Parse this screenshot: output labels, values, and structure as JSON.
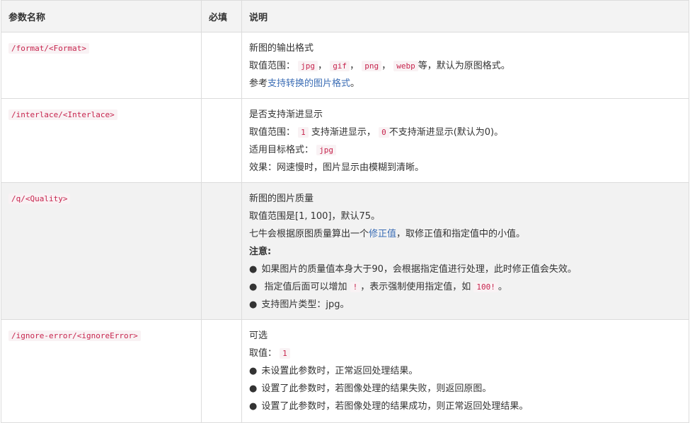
{
  "header": {
    "col_name": "参数名称",
    "col_required": "必填",
    "col_desc": "说明"
  },
  "rows": [
    {
      "name": "/format/<Format>",
      "required": "",
      "title": "新图的输出格式",
      "range_prefix": "取值范围：",
      "formats": [
        "jpg",
        "gif",
        "png",
        "webp"
      ],
      "range_sep": "，",
      "range_suffix": "等，默认为原图格式。",
      "ref_prefix": "参考",
      "ref_link": "支持转换的图片格式",
      "ref_suffix": "。"
    },
    {
      "name": "/interlace/<Interlace>",
      "required": "",
      "title": "是否支持渐进显示",
      "range_prefix": "取值范围：",
      "val1": "1",
      "val1_text": "支持渐进显示，",
      "val0": "0",
      "val0_text": "不支持渐进显示(默认为0)。",
      "target_prefix": "适用目标格式：",
      "target_code": "jpg",
      "effect": "效果：网速慢时，图片显示由模糊到清晰。"
    },
    {
      "name": "/q/<Quality>",
      "required": "",
      "title": "新图的图片质量",
      "range": "取值范围是[1, 100]，默认75。",
      "calc_prefix": "七牛会根据原图质量算出一个",
      "calc_link": "修正值",
      "calc_suffix": "，取修正值和指定值中的小值。",
      "note": "注意:",
      "bullet1": "如果图片的质量值本身大于90，会根据指定值进行处理，此时修正值会失效。",
      "bullet2_prefix": "指定值后面可以增加",
      "bullet2_code1": "!",
      "bullet2_mid": "，表示强制使用指定值，如",
      "bullet2_code2": "100!",
      "bullet2_suffix": "。",
      "bullet3": "支持图片类型：jpg。"
    },
    {
      "name": "/ignore-error/<ignoreError>",
      "required": "",
      "title": "可选",
      "value_prefix": "取值：",
      "value_code": "1",
      "bullet1": "未设置此参数时，正常返回处理结果。",
      "bullet2": "设置了此参数时，若图像处理的结果失败，则返回原图。",
      "bullet3": "设置了此参数时，若图像处理的结果成功，则正常返回处理结果。"
    }
  ]
}
